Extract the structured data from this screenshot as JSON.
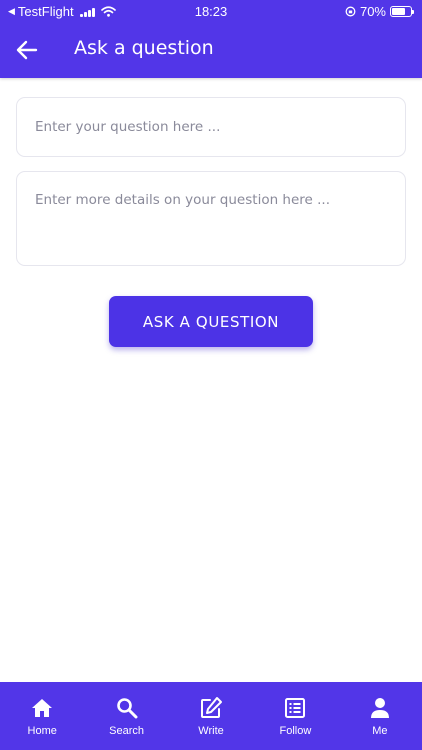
{
  "status_bar": {
    "back_app": "TestFlight",
    "time": "18:23",
    "battery_percent": "70%",
    "battery_level": 0.7
  },
  "header": {
    "title": "Ask a question"
  },
  "form": {
    "question_placeholder": "Enter your question here ...",
    "question_value": "",
    "details_placeholder": "Enter more details on your question here ...",
    "details_value": "",
    "submit_label": "ASK A QUESTION"
  },
  "bottom_nav": {
    "items": [
      {
        "label": "Home",
        "icon": "home-icon"
      },
      {
        "label": "Search",
        "icon": "search-icon"
      },
      {
        "label": "Write",
        "icon": "edit-icon"
      },
      {
        "label": "Follow",
        "icon": "list-icon"
      },
      {
        "label": "Me",
        "icon": "person-icon"
      }
    ]
  },
  "colors": {
    "primary": "#5236e8",
    "button": "#4c33e6",
    "field_border": "#e6e6ee",
    "placeholder": "#8a8a9a"
  }
}
